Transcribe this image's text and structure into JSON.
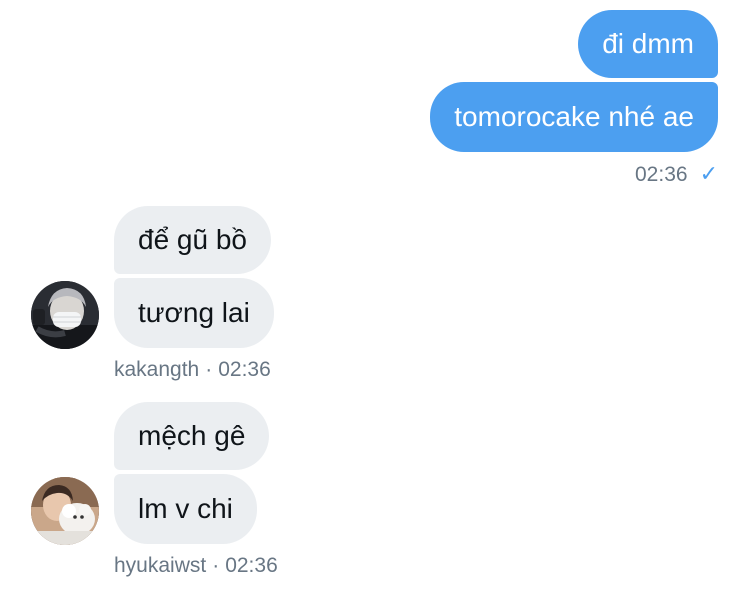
{
  "conversation": {
    "outgoing": {
      "messages": [
        "đi dmm",
        "tomorocake nhé ae"
      ],
      "time": "02:36",
      "status_glyph": "✓"
    },
    "groups": [
      {
        "username": "kakangth",
        "separator": "·",
        "time": "02:36",
        "messages": [
          "để gũ bồ",
          "tương lai"
        ],
        "avatar_icon": "user-avatar-masked-person"
      },
      {
        "username": "hyukaiwst",
        "separator": "·",
        "time": "02:36",
        "messages": [
          "mệch gê",
          "lm v chi"
        ],
        "avatar_icon": "user-avatar-person-with-plush"
      }
    ]
  },
  "colors": {
    "outgoing_bubble": "#4c9ff0",
    "incoming_bubble": "#ebeef1",
    "meta_text": "#687684",
    "incoming_text": "#0f1419"
  }
}
